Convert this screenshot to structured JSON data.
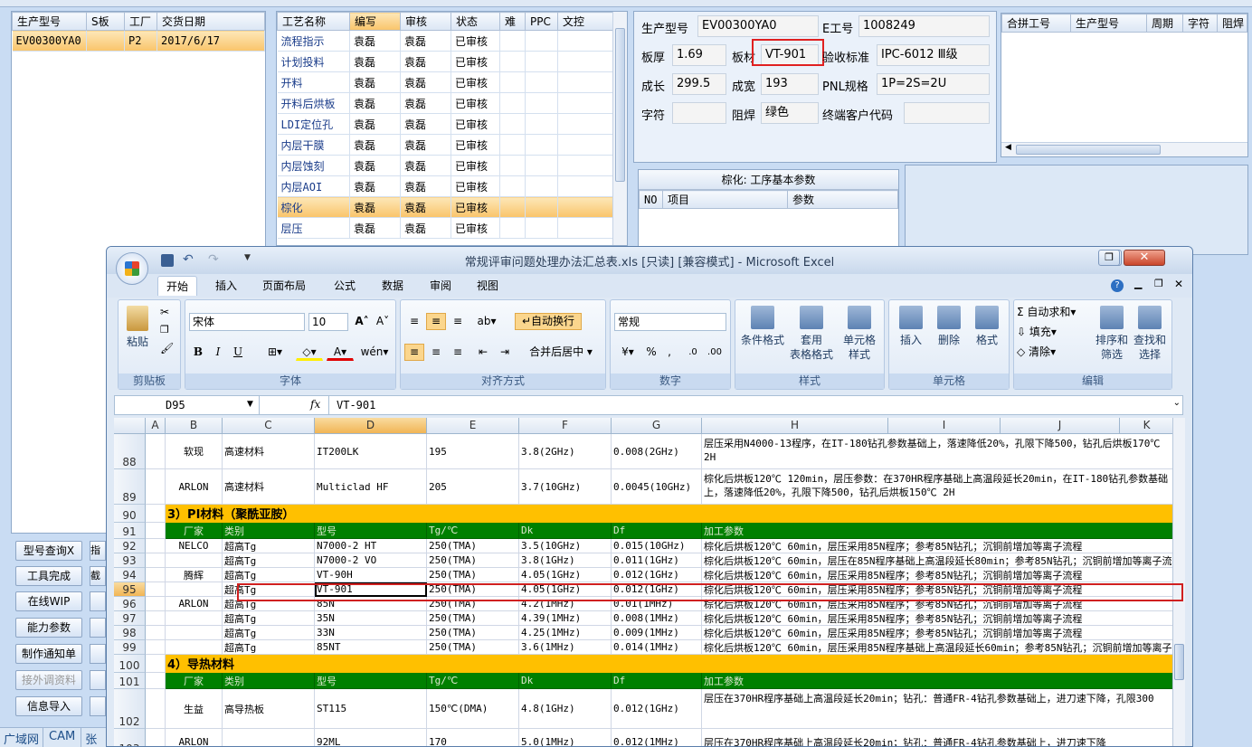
{
  "topbar": {
    "items": [
      "广域网",
      "CAM",
      "张"
    ]
  },
  "orders": {
    "headers": [
      "生产型号",
      "S板",
      "工厂",
      "交货日期"
    ],
    "rows": [
      [
        "EV00300YA0",
        "",
        "P2",
        "2017/6/17"
      ]
    ]
  },
  "process": {
    "headers": [
      "工艺名称",
      "编写",
      "审核",
      "状态",
      "难",
      "PPC",
      "文控"
    ],
    "rows": [
      [
        "流程指示",
        "袁磊",
        "袁磊",
        "已审核"
      ],
      [
        "计划投料",
        "袁磊",
        "袁磊",
        "已审核"
      ],
      [
        "开料",
        "袁磊",
        "袁磊",
        "已审核"
      ],
      [
        "开料后烘板",
        "袁磊",
        "袁磊",
        "已审核"
      ],
      [
        "LDI定位孔",
        "袁磊",
        "袁磊",
        "已审核"
      ],
      [
        "内层干膜",
        "袁磊",
        "袁磊",
        "已审核"
      ],
      [
        "内层蚀刻",
        "袁磊",
        "袁磊",
        "已审核"
      ],
      [
        "内层AOI",
        "袁磊",
        "袁磊",
        "已审核"
      ],
      [
        "棕化",
        "袁磊",
        "袁磊",
        "已审核"
      ],
      [
        "层压",
        "袁磊",
        "袁磊",
        "已审核"
      ]
    ],
    "selected": 8
  },
  "info": {
    "model_label": "生产型号",
    "model": "EV00300YA0",
    "eno_label": "E工号",
    "eno": "1008249",
    "thick_label": "板厚",
    "thick": "1.69",
    "mat_label": "板材",
    "mat": "VT-901",
    "std_label": "验收标准",
    "std": "IPC-6012 Ⅲ级",
    "len_label": "成长",
    "len": "299.5",
    "wid_label": "成宽",
    "wid": "193",
    "pnl_label": "PNL规格",
    "pnl": "1P=2S=2U",
    "char_label": "字符",
    "char": "",
    "mask_label": "阻焊",
    "mask": "绿色",
    "cust_label": "终端客户代码",
    "cust": ""
  },
  "merge": {
    "headers": [
      "合拼工号",
      "生产型号",
      "周期",
      "字符",
      "阻焊"
    ]
  },
  "params": {
    "title": "棕化: 工序基本参数",
    "headers": [
      "NO",
      "项目",
      "参数"
    ]
  },
  "buttons": [
    {
      "label": "型号查询X",
      "dis": false
    },
    {
      "label": "工具完成",
      "dis": false
    },
    {
      "label": "在线WIP",
      "dis": false
    },
    {
      "label": "能力参数",
      "dis": false
    },
    {
      "label": "制作通知单",
      "dis": false
    },
    {
      "label": "接外调资料",
      "dis": true
    },
    {
      "label": "信息导入",
      "dis": false
    }
  ],
  "btn2": [
    "指",
    "截",
    "",
    "",
    "",
    "",
    "",
    "",
    "",
    "",
    ""
  ],
  "excel": {
    "title": "常规评审问题处理办法汇总表.xls [只读] [兼容模式] - Microsoft Excel",
    "tabs": [
      "开始",
      "插入",
      "页面布局",
      "公式",
      "数据",
      "审阅",
      "视图"
    ],
    "font": "宋体",
    "size": "10",
    "wrap": "自动换行",
    "numfmt": "常规",
    "merge": "合并后居中",
    "groups": {
      "clip": "剪贴板",
      "font": "字体",
      "align": "对齐方式",
      "num": "数字",
      "style": "样式",
      "cells": "单元格",
      "edit": "编辑"
    },
    "btns": {
      "paste": "粘贴",
      "cond": "条件格式",
      "tbl1": "套用",
      "tbl2": "表格格式",
      "cs1": "单元格",
      "cs2": "样式",
      "ins": "插入",
      "del": "删除",
      "fmt": "格式",
      "sum": "自动求和",
      "fill": "填充",
      "clear": "清除",
      "sort1": "排序和",
      "sort2": "筛选",
      "find1": "查找和",
      "find2": "选择"
    },
    "namebox": "D95",
    "fx": "fx",
    "formula": "VT-901",
    "cols": [
      "A",
      "B",
      "C",
      "D",
      "E",
      "F",
      "G",
      "H",
      "I",
      "J",
      "K"
    ],
    "rows": [
      {
        "n": "88",
        "c": [
          "",
          "软现",
          "高速材料",
          "IT200LK",
          "195",
          "3.8(2GHz)",
          "0.008(2GHz)",
          "层压采用N4000-13程序，在IT-180钻孔参数基础上，落速降低20%，孔限下降500，钻孔后烘板170℃ 2H"
        ]
      },
      {
        "n": "89",
        "c": [
          "",
          "ARLON",
          "高速材料",
          "Multiclad HF",
          "205",
          "3.7(10GHz)",
          "0.0045(10GHz)",
          "棕化后烘板120℃ 120min，层压参数：在370HR程序基础上高温段延长20min，在IT-180钻孔参数基础上，落速降低20%，孔限下降500，钻孔后烘板150℃ 2H"
        ]
      },
      {
        "n": "90",
        "sec": "3）PI材料（聚酰亚胺）"
      },
      {
        "n": "91",
        "hdr": [
          "厂家",
          "类别",
          "型号",
          "Tg/℃",
          "Dk",
          "Df",
          "加工参数"
        ]
      },
      {
        "n": "92",
        "c": [
          "",
          "NELCO",
          "超高Tg",
          "N7000-2 HT",
          "250(TMA)",
          "3.5(10GHz)",
          "0.015(10GHz)",
          "棕化后烘板120℃ 60min，层压采用85N程序；参考85N钻孔；沉铜前增加等离子流程"
        ]
      },
      {
        "n": "93",
        "c": [
          "",
          "",
          "超高Tg",
          "N7000-2 VO",
          "250(TMA)",
          "3.8(1GHz)",
          "0.011(1GHz)",
          "棕化后烘板120℃ 60min，层压在85N程序基础上高温段延长80min；参考85N钻孔；沉铜前增加等离子流程"
        ]
      },
      {
        "n": "94",
        "c": [
          "",
          "腾辉",
          "超高Tg",
          "VT-90H",
          "250(TMA)",
          "4.05(1GHz)",
          "0.012(1GHz)",
          "棕化后烘板120℃ 60min，层压采用85N程序；参考85N钻孔；沉铜前增加等离子流程"
        ]
      },
      {
        "n": "95",
        "c": [
          "",
          "",
          "超高Tg",
          "VT-901",
          "250(TMA)",
          "4.05(1GHz)",
          "0.012(1GHz)",
          "棕化后烘板120℃ 60min，层压采用85N程序；参考85N钻孔；沉铜前增加等离子流程"
        ]
      },
      {
        "n": "96",
        "c": [
          "",
          "ARLON",
          "超高Tg",
          "85N",
          "250(TMA)",
          "4.2(1MHz)",
          "0.01(1MHz)",
          "棕化后烘板120℃ 60min，层压采用85N程序；参考85N钻孔；沉铜前增加等离子流程"
        ]
      },
      {
        "n": "97",
        "c": [
          "",
          "",
          "超高Tg",
          "35N",
          "250(TMA)",
          "4.39(1MHz)",
          "0.008(1MHz)",
          "棕化后烘板120℃ 60min，层压采用85N程序；参考85N钻孔；沉铜前增加等离子流程"
        ]
      },
      {
        "n": "98",
        "c": [
          "",
          "",
          "超高Tg",
          "33N",
          "250(TMA)",
          "4.25(1MHz)",
          "0.009(1MHz)",
          "棕化后烘板120℃ 60min，层压采用85N程序；参考85N钻孔；沉铜前增加等离子流程"
        ]
      },
      {
        "n": "99",
        "c": [
          "",
          "",
          "超高Tg",
          "85NT",
          "250(TMA)",
          "3.6(1MHz)",
          "0.014(1MHz)",
          "棕化后烘板120℃ 60min，层压采用85N程序基础上高温段延长60min；参考85N钻孔；沉铜前增加等离子流程"
        ]
      },
      {
        "n": "100",
        "sec": "4）导热材料"
      },
      {
        "n": "101",
        "hdr": [
          "厂家",
          "类别",
          "型号",
          "Tg/℃",
          "Dk",
          "Df",
          "加工参数"
        ]
      },
      {
        "n": "102",
        "c": [
          "",
          "生益",
          "高导热板",
          "ST115",
          "150℃(DMA)",
          "4.8(1GHz)",
          "0.012(1GHz)",
          "层压在370HR程序基础上高温段延长20min；钻孔：普通FR-4钻孔参数基础上，进刀速下降，孔限300"
        ]
      },
      {
        "n": "103",
        "c": [
          "",
          "ARLON",
          "",
          "92ML",
          "170",
          "5.0(1MHz)",
          "0.012(1MHz)",
          "层压在370HR程序基础上高温段延长20min；钻孔：普通FR-4钻孔参数基础上，进刀速下降"
        ]
      }
    ]
  }
}
